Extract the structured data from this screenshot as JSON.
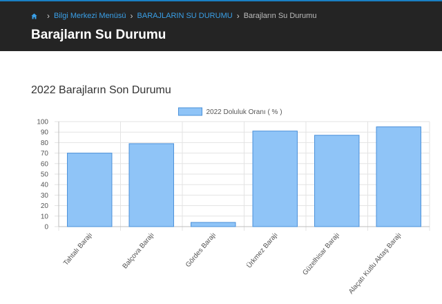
{
  "breadcrumb": {
    "items": [
      "Bilgi Merkezi Menüsü",
      "BARAJLARIN SU DURUMU"
    ],
    "current": "Barajların Su Durumu",
    "separator": "›"
  },
  "page": {
    "title": "Barajların Su Durumu",
    "section_title": "2022 Barajların Son Durumu"
  },
  "colors": {
    "header_bg": "#242424",
    "accent": "#1a7fc4",
    "bar_fill": "#8fc4f7",
    "bar_stroke": "#4a90d9"
  },
  "chart_data": {
    "type": "bar",
    "legend": "2022 Doluluk Oranı ( % )",
    "legend_position": "top-center",
    "categories": [
      "Tahtalı Barajı",
      "Balçova Barajı",
      "Gördes Barajı",
      "Ürkmez Barajı",
      "Güzelhisar Barajı",
      "Alaçatı Kutlu Aktaş Barajı"
    ],
    "series": [
      {
        "name": "2022 Doluluk Oranı ( % )",
        "values": [
          70,
          79,
          4,
          91,
          87,
          95
        ]
      }
    ],
    "ylim": [
      0,
      100
    ],
    "yticks": [
      "0",
      "10",
      "20",
      "30",
      "40",
      "50",
      "60",
      "70",
      "80",
      "90",
      "100"
    ],
    "grid": true
  }
}
